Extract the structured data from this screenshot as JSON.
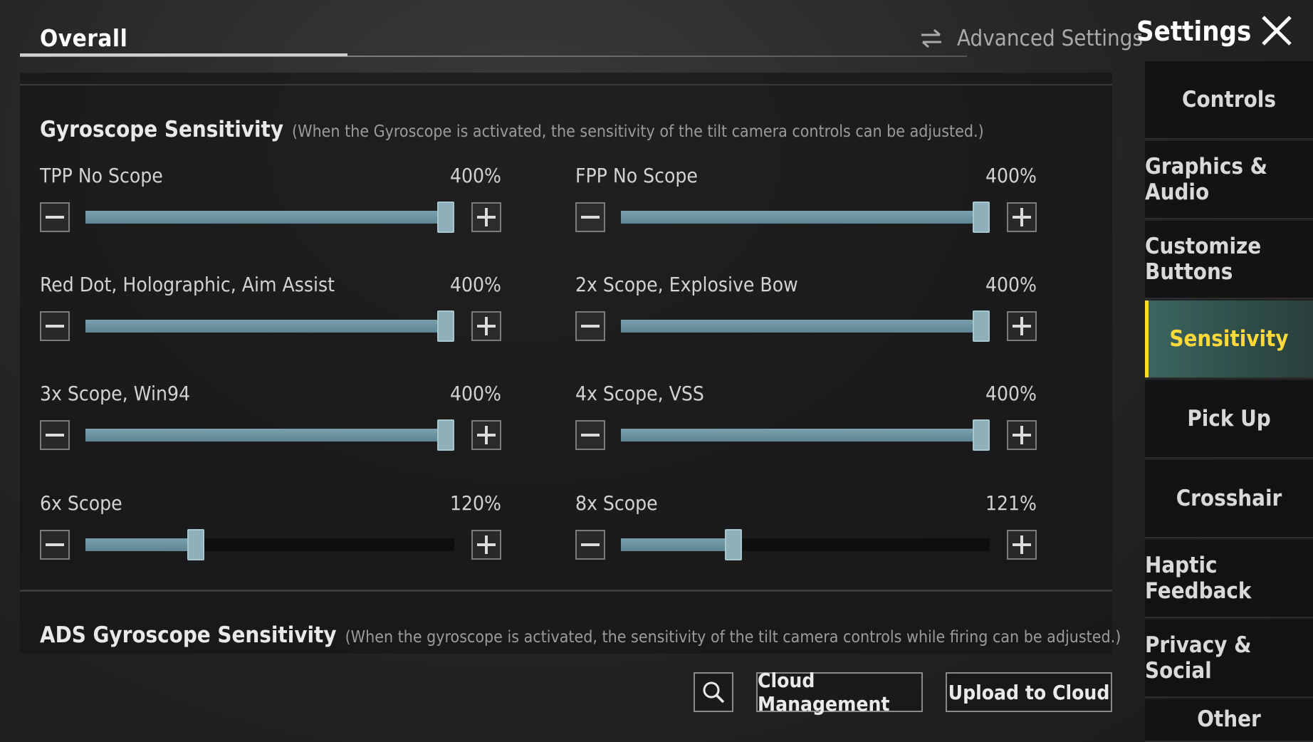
{
  "header": {
    "tab_overall": "Overall",
    "advanced_settings": "Advanced Settings",
    "settings_title": "Settings"
  },
  "gyro": {
    "title": "Gyroscope Sensitivity",
    "hint": "(When the Gyroscope is activated, the sensitivity of the tilt camera controls can be adjusted.)",
    "sliders": [
      {
        "label": "TPP No Scope",
        "value_text": "400%",
        "fraction": 1.0
      },
      {
        "label": "FPP No Scope",
        "value_text": "400%",
        "fraction": 1.0
      },
      {
        "label": "Red Dot, Holographic, Aim Assist",
        "value_text": "400%",
        "fraction": 1.0
      },
      {
        "label": "2x Scope, Explosive Bow",
        "value_text": "400%",
        "fraction": 1.0
      },
      {
        "label": "3x Scope, Win94",
        "value_text": "400%",
        "fraction": 1.0
      },
      {
        "label": "4x Scope, VSS",
        "value_text": "400%",
        "fraction": 1.0
      },
      {
        "label": "6x Scope",
        "value_text": "120%",
        "fraction": 0.3
      },
      {
        "label": "8x Scope",
        "value_text": "121%",
        "fraction": 0.305
      }
    ]
  },
  "ads_gyro": {
    "title": "ADS Gyroscope Sensitivity",
    "hint": "(When the gyroscope is activated, the sensitivity of the tilt camera controls while firing can be adjusted.)"
  },
  "sidebar": {
    "items": [
      {
        "label": "Controls",
        "active": false
      },
      {
        "label": "Graphics & Audio",
        "active": false
      },
      {
        "label": "Customize Buttons",
        "active": false
      },
      {
        "label": "Sensitivity",
        "active": true
      },
      {
        "label": "Pick Up",
        "active": false
      },
      {
        "label": "Crosshair",
        "active": false
      },
      {
        "label": "Haptic Feedback",
        "active": false
      },
      {
        "label": "Privacy & Social",
        "active": false
      },
      {
        "label": "Other",
        "active": false
      }
    ]
  },
  "bottom": {
    "cloud_management": "Cloud Management",
    "upload_to_cloud": "Upload to Cloud"
  },
  "colors": {
    "accent_yellow": "#ffd83a",
    "slider_fill": "#6b93a1",
    "active_tab_bg": "#3d6660"
  },
  "icons": {
    "advanced": "swap-arrows-icon",
    "close": "close-icon",
    "search": "search-icon",
    "decrease": "minus-icon",
    "increase": "plus-icon"
  }
}
